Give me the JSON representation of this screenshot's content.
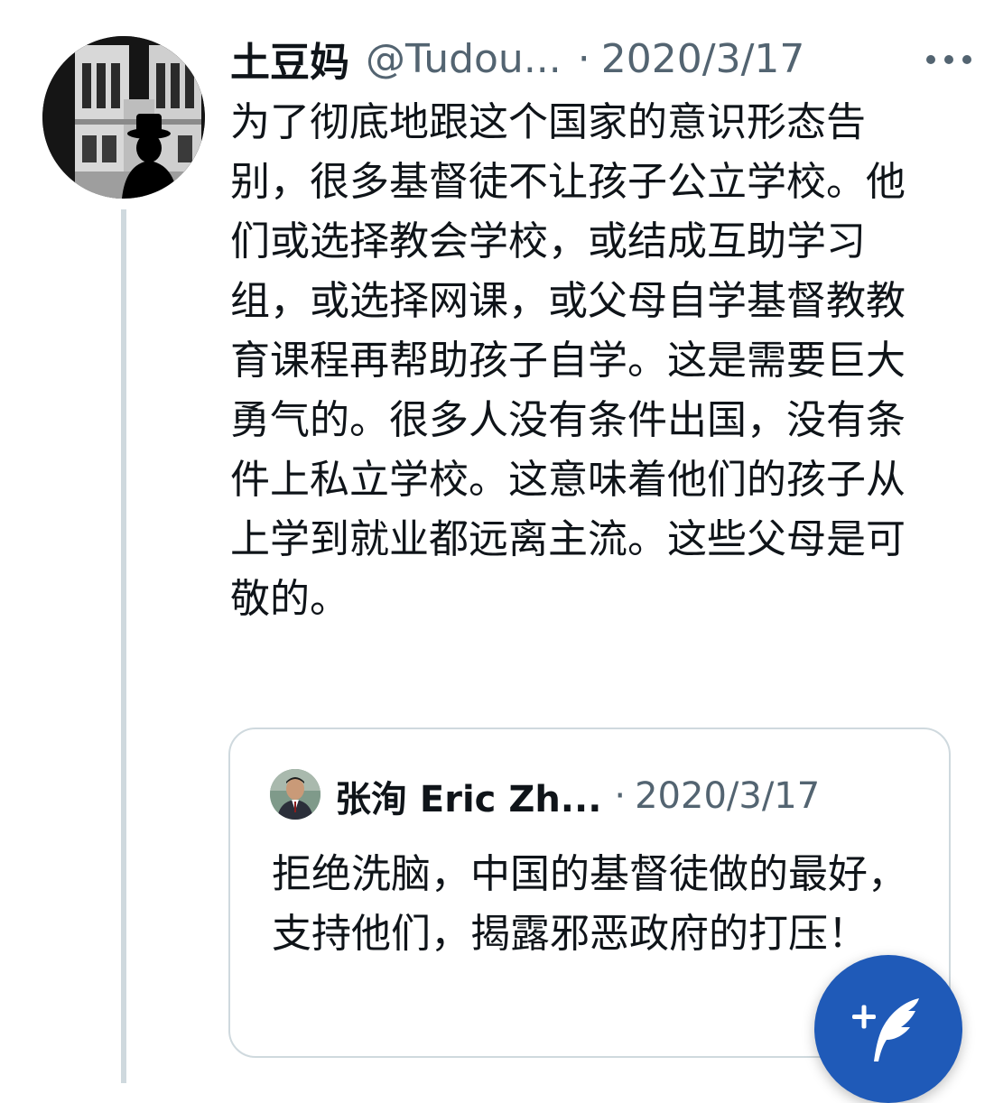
{
  "tweet": {
    "display_name": "土豆妈",
    "handle": "@Tudou...",
    "separator": "·",
    "date": "2020/3/17",
    "more_icon": "more-horizontal-icon",
    "text": "为了彻底地跟这个国家的意识形态告别，很多基督徒不让孩子公立学校。他们或选择教会学校，或结成互助学习组，或选择网课，或父母自学基督教教育课程再帮助孩子自学。这是需要巨大勇气的。很多人没有条件出国，没有条件上私立学校。这意味着他们的孩子从上学到就业都远离主流。这些父母是可敬的。"
  },
  "quote": {
    "display_name": "张洵 Eric Zh...",
    "separator": "·",
    "date": "2020/3/17",
    "text": "拒绝洗脑，中国的基督徒做的最好，支持他们，揭露邪恶政府的打压！"
  },
  "fab": {
    "icon": "compose-tweet-icon",
    "color": "#1f5ab8"
  },
  "colors": {
    "text": "#0f1419",
    "secondary": "#536471",
    "border": "#cfd9de"
  }
}
